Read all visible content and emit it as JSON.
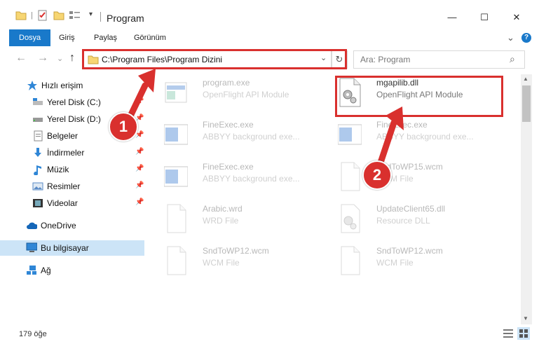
{
  "window": {
    "title": "Program",
    "controls": {
      "minimize": "—",
      "maximize": "☐",
      "close": "✕"
    }
  },
  "ribbon": {
    "tabs": [
      "Dosya",
      "Giriş",
      "Paylaş",
      "Görünüm"
    ],
    "expand_icon": "⌄",
    "help_icon": "?"
  },
  "address_bar": {
    "back": "←",
    "forward": "→",
    "recent": "⌄",
    "up": "↑",
    "path": "C:\\Program Files\\Program Dizini",
    "dropdown": "⌄",
    "refresh": "↻"
  },
  "search": {
    "placeholder": "Ara: Program",
    "icon": "⌕"
  },
  "nav_pane": {
    "items": [
      {
        "label": "Hızlı erişim",
        "icon": "star-icon",
        "pinned": false
      },
      {
        "label": "Yerel Disk (C:)",
        "icon": "drive-icon",
        "pinned": true
      },
      {
        "label": "Yerel Disk (D:)",
        "icon": "drive-icon",
        "pinned": true
      },
      {
        "label": "Belgeler",
        "icon": "documents-icon",
        "pinned": true
      },
      {
        "label": "İndirmeler",
        "icon": "downloads-icon",
        "pinned": true
      },
      {
        "label": "Müzik",
        "icon": "music-icon",
        "pinned": true
      },
      {
        "label": "Resimler",
        "icon": "pictures-icon",
        "pinned": true
      },
      {
        "label": "Videolar",
        "icon": "videos-icon",
        "pinned": true
      },
      {
        "label": "OneDrive",
        "icon": "cloud-icon",
        "pinned": false
      },
      {
        "label": "Bu bilgisayar",
        "icon": "computer-icon",
        "pinned": false,
        "selected": true
      },
      {
        "label": "Ağ",
        "icon": "network-icon",
        "pinned": false
      }
    ],
    "pin_glyph": "📌"
  },
  "files": [
    {
      "name": "program.exe",
      "type": "OpenFlight API Module",
      "icon": "exe-icon",
      "faded": true
    },
    {
      "name": "mgapilib.dll",
      "type": "OpenFlight API Module",
      "icon": "dll-icon",
      "faded": false,
      "highlighted": true
    },
    {
      "name": "FineExec.exe",
      "type": "ABBYY background exe...",
      "icon": "app-window-icon",
      "faded": true
    },
    {
      "name": "FineExec.exe",
      "type": "ABBYY background exe...",
      "icon": "app-window-icon",
      "faded": true
    },
    {
      "name": "FineExec.exe",
      "type": "ABBYY background exe...",
      "icon": "app-window-icon",
      "faded": true
    },
    {
      "name": "SndToWP15.wcm",
      "type": "WCM File",
      "icon": "file-icon",
      "faded": true
    },
    {
      "name": "Arabic.wrd",
      "type": "WRD File",
      "icon": "file-icon",
      "faded": true
    },
    {
      "name": "UpdateClient65.dll",
      "type": "Resource DLL",
      "icon": "dll-icon",
      "faded": true
    },
    {
      "name": "SndToWP12.wcm",
      "type": "WCM File",
      "icon": "file-icon",
      "faded": true
    },
    {
      "name": "SndToWP12.wcm",
      "type": "WCM File",
      "icon": "file-icon",
      "faded": true
    }
  ],
  "status": {
    "count": "179 öğe"
  },
  "annotations": {
    "callout_1": "1",
    "callout_2": "2",
    "color": "#d9302e"
  },
  "colors": {
    "accent": "#1979ca",
    "selection": "#cce4f7"
  }
}
